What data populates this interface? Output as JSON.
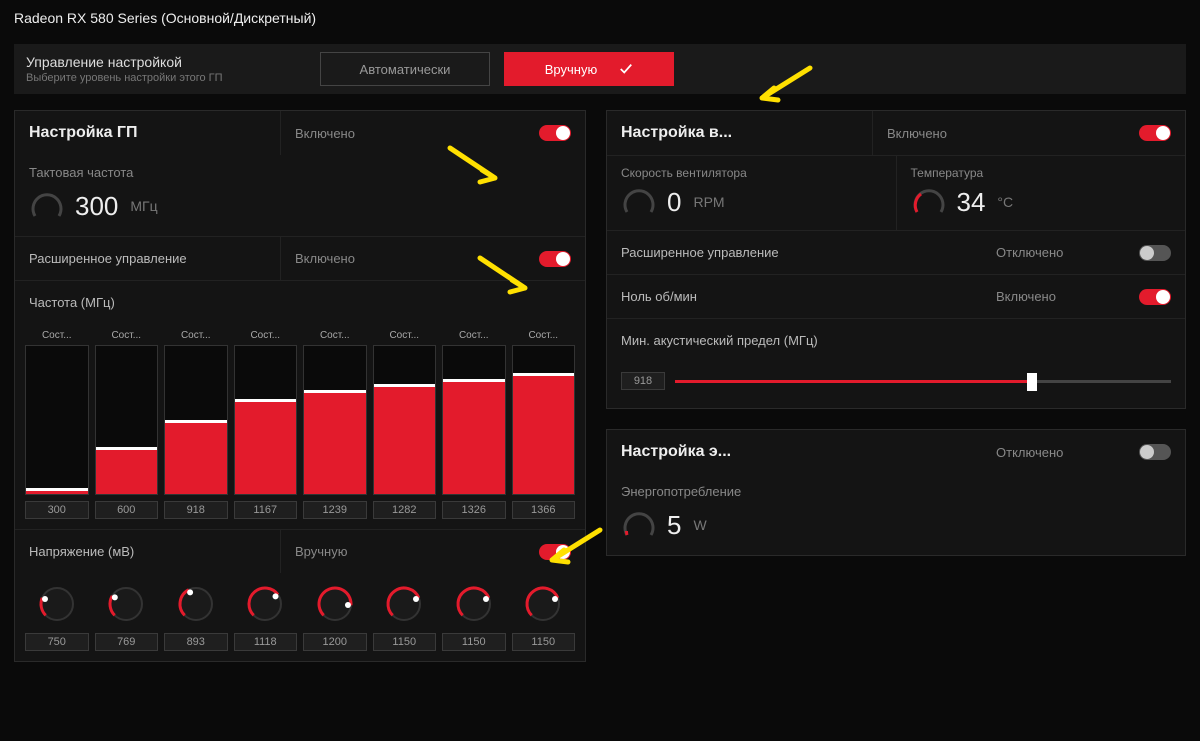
{
  "title": "Radeon RX 580 Series (Основной/Дискретный)",
  "tuning_control": {
    "title": "Управление настройкой",
    "subtitle": "Выберите уровень настройки этого ГП",
    "auto_label": "Автоматически",
    "manual_label": "Вручную"
  },
  "gpu": {
    "header": "Настройка ГП",
    "enabled_label": "Включено",
    "clock_label": "Тактовая частота",
    "clock_value": "300",
    "clock_unit": "МГц",
    "advanced_label": "Расширенное управление",
    "advanced_value": "Включено",
    "freq_label": "Частота (МГц)",
    "state_labels": [
      "Сост...",
      "Сост...",
      "Сост...",
      "Сост...",
      "Сост...",
      "Сост...",
      "Сост...",
      "Сост..."
    ],
    "freq_values": [
      "300",
      "600",
      "918",
      "1167",
      "1239",
      "1282",
      "1326",
      "1366"
    ],
    "freq_heights": [
      4,
      32,
      50,
      64,
      70,
      74,
      78,
      82
    ],
    "voltage_label": "Напряжение (мВ)",
    "voltage_mode": "Вручную",
    "voltage_values": [
      "750",
      "769",
      "893",
      "1118",
      "1200",
      "1150",
      "1150",
      "1150"
    ],
    "voltage_pct": [
      25,
      28,
      40,
      70,
      85,
      75,
      75,
      75
    ]
  },
  "fan": {
    "header": "Настройка в...",
    "enabled_label": "Включено",
    "speed_label": "Скорость вентилятора",
    "speed_value": "0",
    "speed_unit": "RPM",
    "temp_label": "Температура",
    "temp_value": "34",
    "temp_unit": "°C",
    "advanced_label": "Расширенное управление",
    "advanced_value": "Отключено",
    "zero_label": "Ноль об/мин",
    "zero_value": "Включено",
    "acoustic_label": "Мин. акустический предел (МГц)",
    "acoustic_value": "918",
    "acoustic_pct": 72
  },
  "power": {
    "header": "Настройка э...",
    "enabled_label": "Отключено",
    "consumption_label": "Энергопотребление",
    "consumption_value": "5",
    "consumption_unit": "W"
  },
  "colors": {
    "accent": "#e31b2c"
  }
}
